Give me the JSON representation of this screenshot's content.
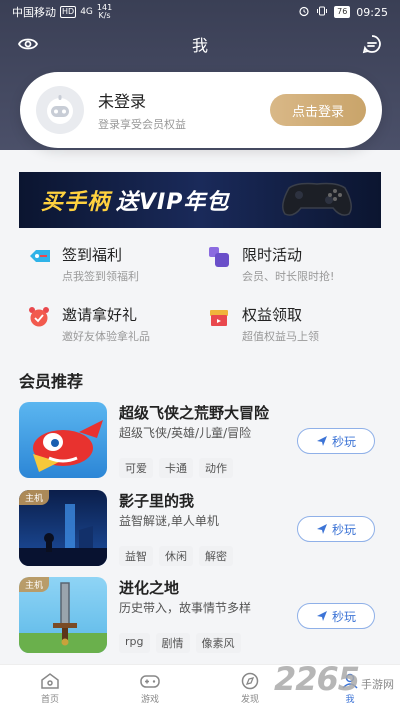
{
  "status_bar": {
    "carrier": "中国移动",
    "hd": "HD",
    "network": "4G",
    "speed_value": "141",
    "speed_unit": "K/s",
    "battery": "76",
    "time": "09:25"
  },
  "header": {
    "title": "我"
  },
  "login": {
    "title": "未登录",
    "subtitle": "登录享受会员权益",
    "button": "点击登录"
  },
  "banner": {
    "text_accent": "买手柄",
    "text_main": "送VIP年包"
  },
  "features": [
    {
      "title": "签到福利",
      "subtitle": "点我签到领福利",
      "icon": "ticket-icon"
    },
    {
      "title": "限时活动",
      "subtitle": "会员、时长限时抢!",
      "icon": "apps-icon"
    },
    {
      "title": "邀请拿好礼",
      "subtitle": "邀好友体验拿礼品",
      "icon": "alarm-clock-icon"
    },
    {
      "title": "权益领取",
      "subtitle": "超值权益马上领",
      "icon": "gift-box-icon"
    }
  ],
  "section": {
    "title": "会员推荐"
  },
  "games": [
    {
      "name": "超级飞侠之荒野大冒险",
      "desc": "超级飞侠/英雄/儿童/冒险",
      "tag_label": "",
      "tags": [
        "可爱",
        "卡通",
        "动作"
      ],
      "button": "秒玩"
    },
    {
      "name": "影子里的我",
      "desc": "益智解谜,单人单机",
      "tag_label": "主机",
      "tags": [
        "益智",
        "休闲",
        "解密"
      ],
      "button": "秒玩"
    },
    {
      "name": "进化之地",
      "desc": "历史带入，故事情节多样",
      "tag_label": "主机",
      "tags": [
        "rpg",
        "剧情",
        "像素风"
      ],
      "button": "秒玩"
    }
  ],
  "tabbar": [
    {
      "label": "首页",
      "icon": "home-icon"
    },
    {
      "label": "游戏",
      "icon": "gamepad-icon"
    },
    {
      "label": "发现",
      "icon": "compass-icon"
    },
    {
      "label": "我",
      "icon": "user-icon"
    }
  ],
  "watermark": {
    "number": "2265",
    "text": "手游网"
  },
  "colors": {
    "header_bg": "#3a3f55",
    "gold": "#c9a46a",
    "accent_blue": "#3d74d6"
  }
}
